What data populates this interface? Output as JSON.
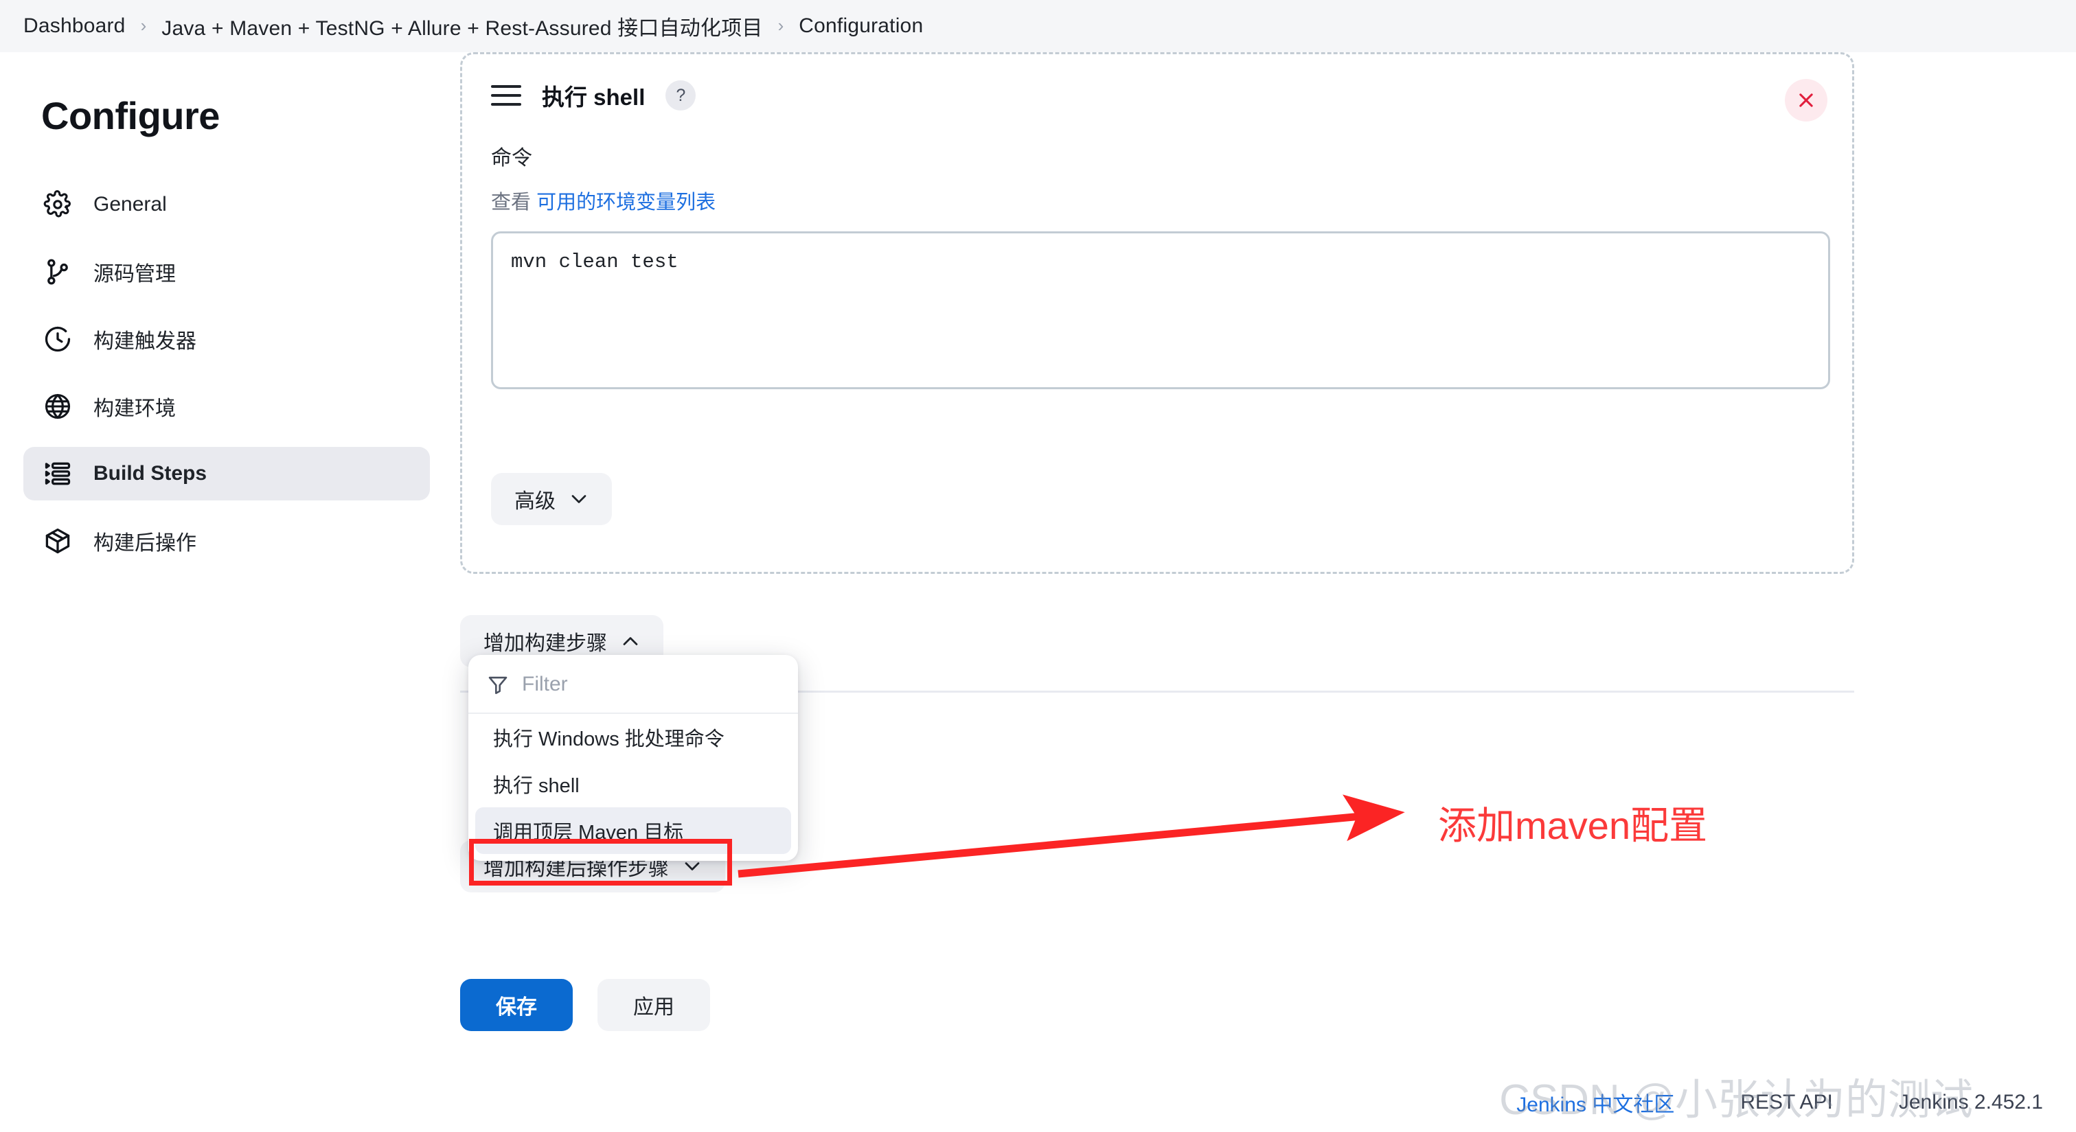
{
  "breadcrumb": {
    "items": [
      "Dashboard",
      "Java + Maven + TestNG + Allure + Rest-Assured 接口自动化项目",
      "Configuration"
    ],
    "separator": "›"
  },
  "sidebar": {
    "title": "Configure",
    "items": [
      {
        "label": "General",
        "icon": "gear-icon",
        "active": false
      },
      {
        "label": "源码管理",
        "icon": "git-branch-icon",
        "active": false
      },
      {
        "label": "构建触发器",
        "icon": "clock-icon",
        "active": false
      },
      {
        "label": "构建环境",
        "icon": "globe-icon",
        "active": false
      },
      {
        "label": "Build Steps",
        "icon": "list-icon",
        "active": true
      },
      {
        "label": "构建后操作",
        "icon": "package-icon",
        "active": false
      }
    ]
  },
  "step_panel": {
    "title": "执行 shell",
    "help_label": "?",
    "close_label": "×",
    "command_label": "命令",
    "env_prefix": "查看",
    "env_link": "可用的环境变量列表",
    "command_value": "mvn clean test",
    "command_placeholder": "",
    "advanced_label": "高级"
  },
  "buttons": {
    "add_build_step": "增加构建步骤",
    "add_post_build_step": "增加构建后操作步骤",
    "save": "保存",
    "apply": "应用"
  },
  "dropdown": {
    "filter_placeholder": "Filter",
    "filter_value": "",
    "items": [
      {
        "label": "执行 Windows 批处理命令",
        "highlighted": false
      },
      {
        "label": "执行 shell",
        "highlighted": false
      },
      {
        "label": "调用顶层 Maven 目标",
        "highlighted": true
      }
    ]
  },
  "annotation": {
    "text": "添加maven配置",
    "color": "#fb3a3a"
  },
  "footer": {
    "community_link": "Jenkins 中文社区",
    "rest_api": "REST API",
    "version": "Jenkins 2.452.1",
    "watermark": "CSDN @小张认为的测试"
  },
  "colors": {
    "accent": "#0b6ad0",
    "link": "#1d6fe0",
    "annotation": "#fb2424",
    "active_nav_bg": "#e9eaef"
  }
}
